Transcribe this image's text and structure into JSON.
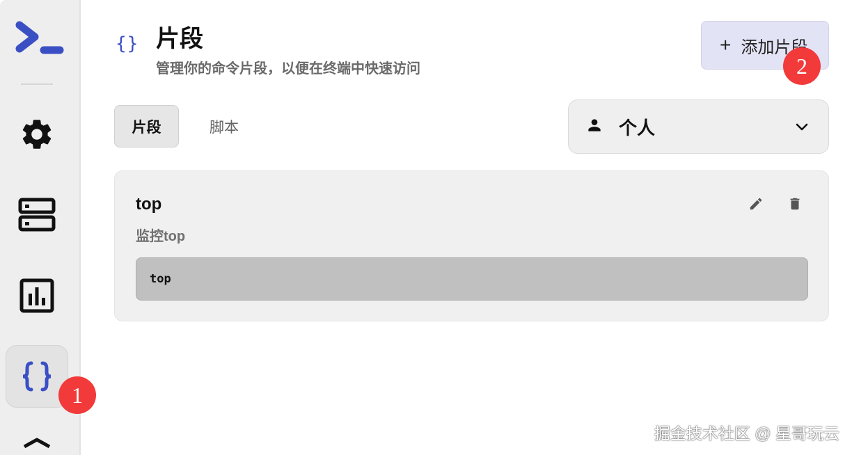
{
  "sidebar": {
    "logo_icon": "terminal-prompt-icon",
    "items": [
      {
        "name": "settings",
        "icon": "gear-icon"
      },
      {
        "name": "hosts",
        "icon": "server-icon"
      },
      {
        "name": "monitor",
        "icon": "bar-chart-icon"
      },
      {
        "name": "snippets",
        "icon": "braces-icon",
        "active": true
      }
    ],
    "accent_color": "#3b4fc4"
  },
  "header": {
    "icon_text": "{}",
    "title": "片段",
    "subtitle": "管理你的命令片段，以便在终端中快速访问",
    "add_button": {
      "plus": "+",
      "label": "添加片段"
    }
  },
  "tabs": [
    {
      "label": "片段",
      "active": true
    },
    {
      "label": "脚本",
      "active": false
    }
  ],
  "scope_select": {
    "icon": "person-icon",
    "value": "个人"
  },
  "snippets": [
    {
      "name": "top",
      "description": "监控top",
      "command": "top"
    }
  ],
  "badges": [
    {
      "label": "1"
    },
    {
      "label": "2"
    }
  ],
  "watermark": "掘金技术社区 @ 星哥玩云"
}
